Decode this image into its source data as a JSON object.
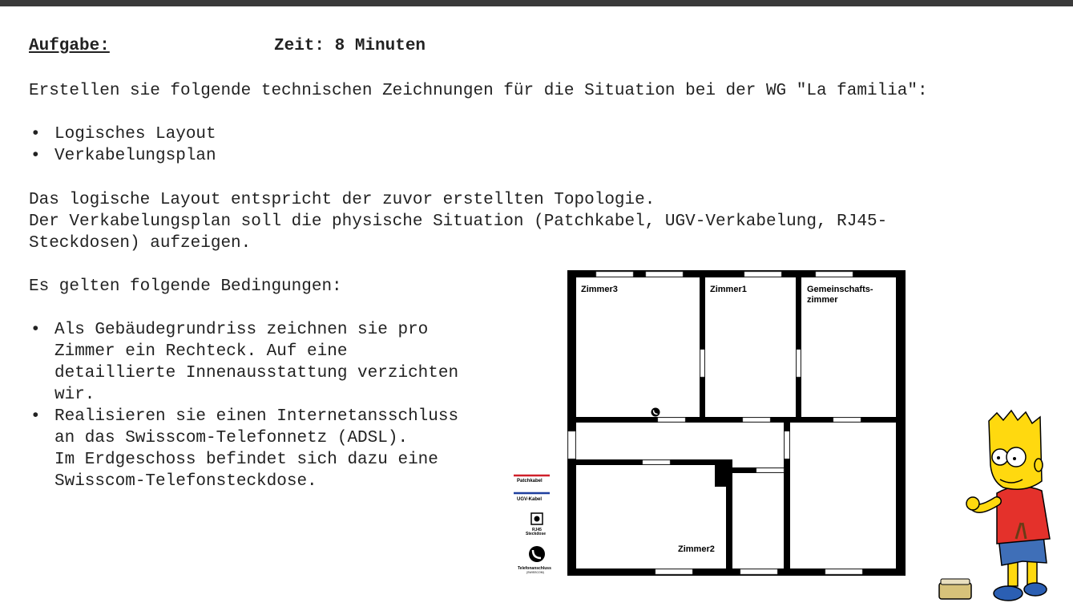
{
  "header": {
    "task_label": "Aufgabe:",
    "time_label": "Zeit: 8 Minuten"
  },
  "intro": "Erstellen sie folgende technischen Zeichnungen für die Situation bei der WG \"La familia\":",
  "drawings": [
    "Logisches Layout",
    "Verkabelungsplan"
  ],
  "description": {
    "line1": "Das logische Layout entspricht der zuvor erstellten Topologie.",
    "line2": "Der Verkabelungsplan soll die physische Situation (Patchkabel, UGV-Verkabelung, RJ45-",
    "line3": "Steckdosen) aufzeigen."
  },
  "conditions_heading": "Es gelten folgende Bedingungen:",
  "conditions": [
    "Als Gebäudegrundriss zeichnen sie pro\nZimmer ein Rechteck. Auf eine\ndetaillierte Innenausstattung verzichten\nwir.",
    "Realisieren sie einen Internetansschluss\nan das Swisscom-Telefonnetz (ADSL).\nIm Erdgeschoss befindet sich dazu eine\nSwisscom-Telefonsteckdose."
  ],
  "floorplan": {
    "rooms": {
      "zimmer3": "Zimmer3",
      "zimmer1": "Zimmer1",
      "gemeinschaft_line1": "Gemeinschafts-",
      "gemeinschaft_line2": "zimmer",
      "zimmer2": "Zimmer2"
    },
    "legend": {
      "patchkabel": "Patchkabel",
      "ugv_kabel": "UGV-Kabel",
      "rj45_line1": "RJ45",
      "rj45_line2": "Steckdose",
      "telefon_line1": "Telefonanschluss",
      "telefon_line2": "(SWISSCOM)"
    },
    "colors": {
      "wall": "#000000",
      "patchkabel": "#d0202a",
      "ugv_kabel": "#1f3f9e"
    }
  }
}
